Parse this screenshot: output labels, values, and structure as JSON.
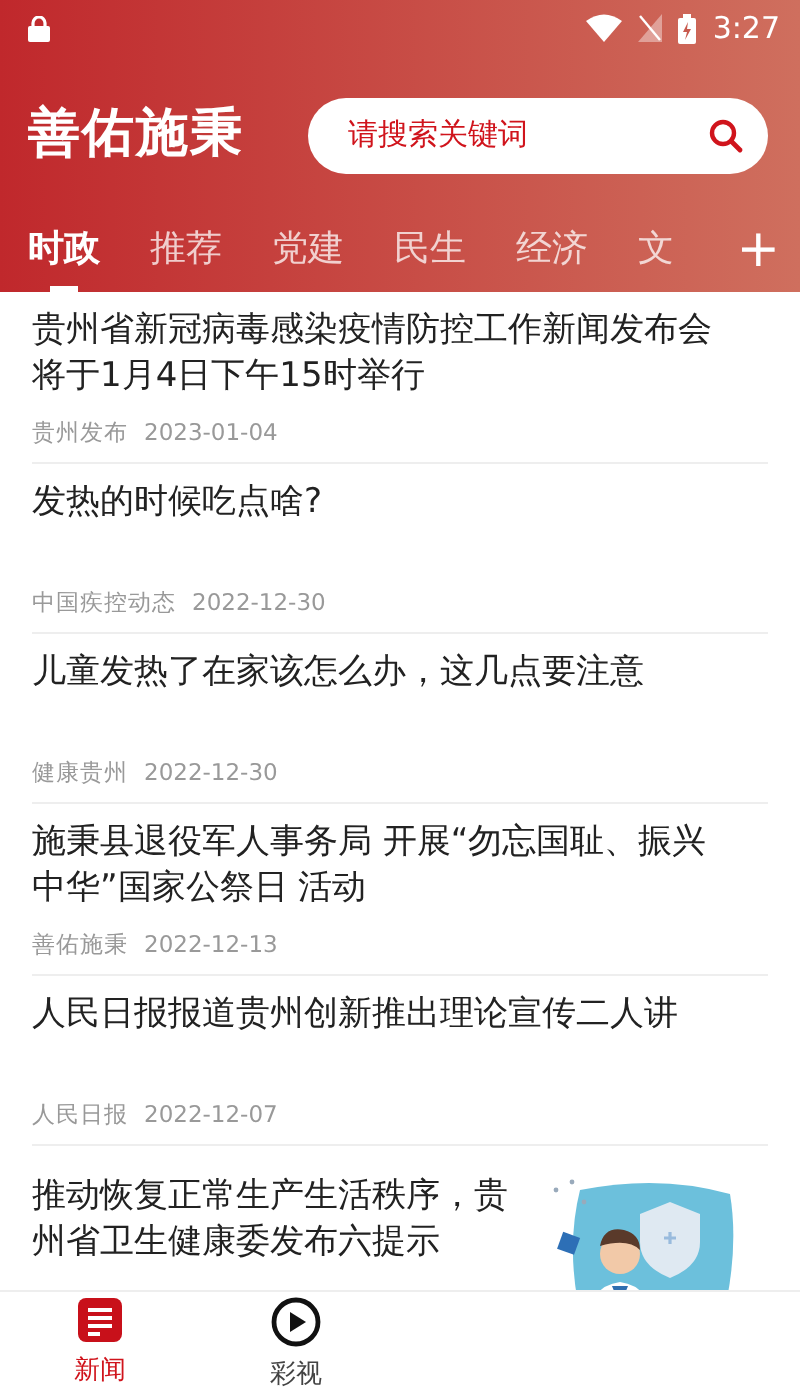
{
  "status_bar": {
    "time": "3:27"
  },
  "header": {
    "logo": "善佑施秉",
    "search": {
      "placeholder": "请搜索关键词"
    }
  },
  "tabs": [
    {
      "label": "时政",
      "selected": true
    },
    {
      "label": "推荐",
      "selected": false
    },
    {
      "label": "党建",
      "selected": false
    },
    {
      "label": "民生",
      "selected": false
    },
    {
      "label": "经济",
      "selected": false
    },
    {
      "label": "文",
      "selected": false
    }
  ],
  "add_button": "+",
  "articles": [
    {
      "kind": "text",
      "title": "贵州省新冠病毒感染疫情防控工作新闻发布会将于1月4日下午15时举行",
      "source": "贵州发布",
      "date": "2023-01-04"
    },
    {
      "kind": "text",
      "title": "发热的时候吃点啥?",
      "source": "中国疾控动态",
      "date": "2022-12-30"
    },
    {
      "kind": "text",
      "title": "儿童发热了在家该怎么办，这几点要注意",
      "source": "健康贵州",
      "date": "2022-12-30"
    },
    {
      "kind": "text",
      "title": "施秉县退役军人事务局 开展“勿忘国耻、振兴中华”国家公祭日 活动",
      "source": "善佑施秉",
      "date": "2022-12-13"
    },
    {
      "kind": "text",
      "title": "人民日报报道贵州创新推出理论宣传二人讲",
      "source": "人民日报",
      "date": "2022-12-07"
    },
    {
      "kind": "picture",
      "title": "推动恢复正常生产生活秩序，贵州省卫生健康委发布六提示"
    }
  ],
  "bottom_nav": [
    {
      "label": "新闻",
      "selected": true
    },
    {
      "label": "彩视",
      "selected": false
    }
  ]
}
